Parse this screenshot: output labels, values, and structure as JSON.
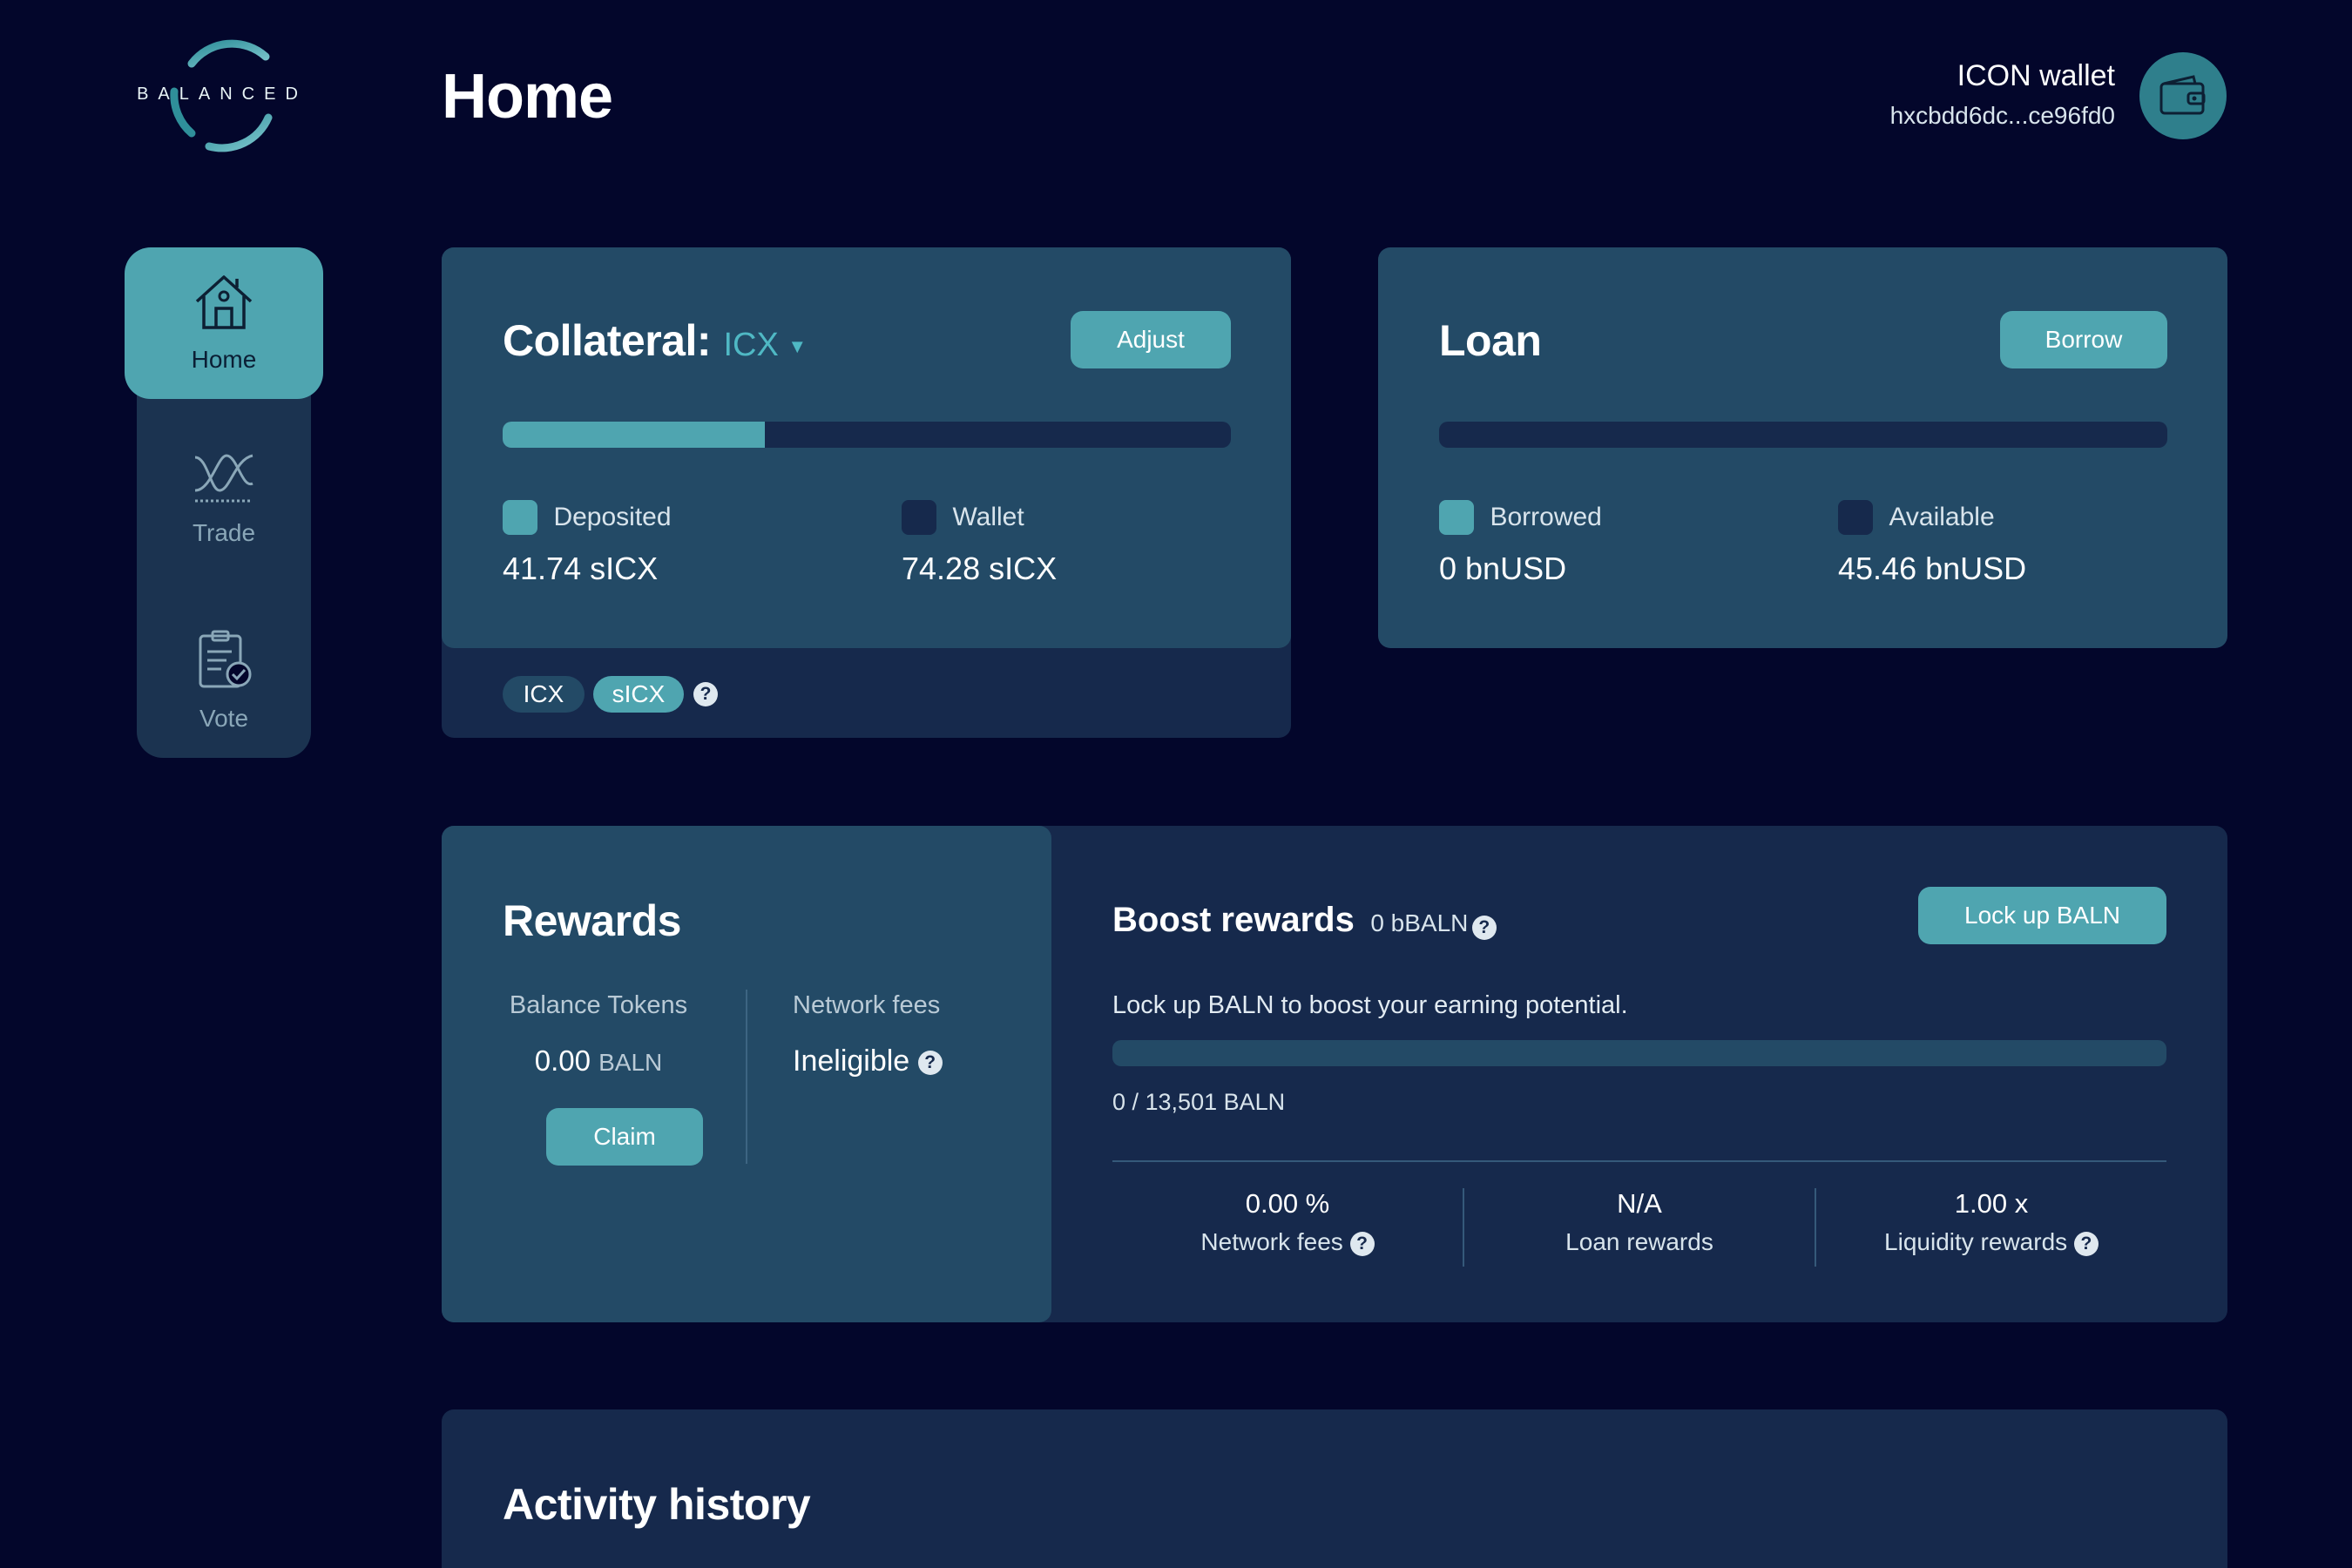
{
  "app": {
    "logo_text": "BALANCED",
    "page_title": "Home"
  },
  "wallet": {
    "name": "ICON wallet",
    "address": "hxcbdd6dc...ce96fd0"
  },
  "sidebar": {
    "items": [
      {
        "label": "Home",
        "icon": "home-icon",
        "active": true
      },
      {
        "label": "Trade",
        "icon": "trade-icon",
        "active": false
      },
      {
        "label": "Vote",
        "icon": "vote-icon",
        "active": false
      }
    ]
  },
  "collateral": {
    "title": "Collateral:",
    "asset": "ICX",
    "adjust_label": "Adjust",
    "progress_fraction": 0.36,
    "deposited_label": "Deposited",
    "deposited_value": "41.74 sICX",
    "wallet_label": "Wallet",
    "wallet_value": "74.28 sICX",
    "toggle": [
      "ICX",
      "sICX"
    ],
    "toggle_selected": "sICX"
  },
  "loan": {
    "title": "Loan",
    "borrow_label": "Borrow",
    "progress_fraction": 0,
    "borrowed_label": "Borrowed",
    "borrowed_value": "0 bnUSD",
    "available_label": "Available",
    "available_value": "45.46 bnUSD"
  },
  "rewards": {
    "title": "Rewards",
    "balance_tokens_label": "Balance Tokens",
    "balance_tokens_amount": "0.00",
    "balance_tokens_unit": "BALN",
    "claim_label": "Claim",
    "network_fees_label": "Network fees",
    "network_fees_value": "Ineligible"
  },
  "boost": {
    "title": "Boost rewards",
    "bbaln": "0 bBALN",
    "lock_label": "Lock up BALN",
    "description": "Lock up BALN to boost your earning potential.",
    "progress_fraction": 0,
    "progress_text": "0 / 13,501 BALN",
    "stats": [
      {
        "value": "0.00 %",
        "label": "Network fees",
        "help": true
      },
      {
        "value": "N/A",
        "label": "Loan rewards",
        "help": false
      },
      {
        "value": "1.00 x",
        "label": "Liquidity rewards",
        "help": true
      }
    ]
  },
  "activity": {
    "title": "Activity history"
  },
  "colors": {
    "background": "#03062b",
    "card": "#234a66",
    "card_dark": "#16294c",
    "accent": "#4fa5b0"
  }
}
